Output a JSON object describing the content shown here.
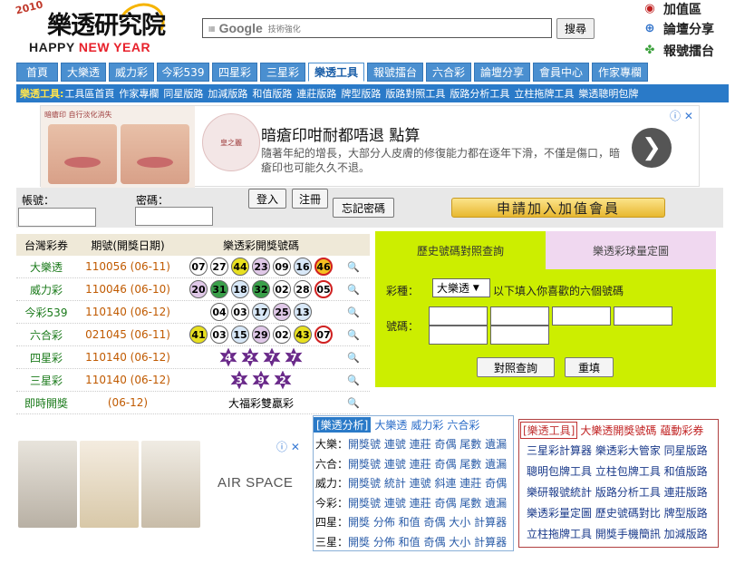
{
  "logo": {
    "year": "2010",
    "title": "樂透研究院",
    "greeting_a": "HAPPY",
    "greeting_b": "NEW YEAR"
  },
  "search": {
    "brand": "Google",
    "sub": "技術強化",
    "button": "搜尋"
  },
  "right_links": [
    "加值區",
    "論壇分享",
    "報號擂台"
  ],
  "nav": [
    {
      "label": "首頁",
      "w": 46
    },
    {
      "label": "大樂透",
      "w": 50
    },
    {
      "label": "威力彩",
      "w": 50
    },
    {
      "label": "今彩539",
      "w": 58
    },
    {
      "label": "四星彩",
      "w": 50
    },
    {
      "label": "三星彩",
      "w": 50
    },
    {
      "label": "樂透工具",
      "w": 62
    },
    {
      "label": "報號擂台",
      "w": 62
    },
    {
      "label": "六合彩",
      "w": 50
    },
    {
      "label": "論壇分享",
      "w": 62
    },
    {
      "label": "會員中心",
      "w": 62
    },
    {
      "label": "作家專欄",
      "w": 62
    }
  ],
  "nav_active": "樂透工具",
  "subnav": {
    "label": "樂透工具:",
    "items": [
      "工具區首頁",
      "作家專欄",
      "同星版路",
      "加減版路",
      "和值版路",
      "連莊版路",
      "牌型版路",
      "版路對照工具",
      "版路分析工具",
      "立柱拖牌工具",
      "樂透聰明包牌"
    ]
  },
  "ad1": {
    "caption": "暗瘡印 自行淡化消失 ",
    "brand": "皇之麗",
    "title": "暗瘡印咁耐都唔退 點算",
    "desc": "隨著年紀的增長，大部分人皮膚的修復能力都在逐年下滑，不僅是傷口，暗瘡印也可能久久不退。",
    "arrow": "❯",
    "close": "ⓘ ✕"
  },
  "login": {
    "account_label": "帳號：",
    "password_label": "密碼：",
    "login_btn": "登入",
    "register_btn": "注冊",
    "forgot_btn": "忘記密碼",
    "vip_btn": "申請加入加值會員"
  },
  "results": {
    "headers": [
      "台灣彩券",
      "期號(開獎日期)",
      "樂透彩開獎號碼",
      ""
    ],
    "rows": [
      {
        "game": "大樂透",
        "period": "110056 (06-11)",
        "type": "ball",
        "balls": [
          [
            "07",
            "#fff"
          ],
          [
            "27",
            "#fff"
          ],
          [
            "44",
            "#e8e020"
          ],
          [
            "23",
            "#e0c8e8"
          ],
          [
            "09",
            "#fff"
          ],
          [
            "16",
            "#d8e8f8"
          ],
          [
            "46",
            "#f5c020"
          ]
        ],
        "special_last": true
      },
      {
        "game": "威力彩",
        "period": "110046 (06-10)",
        "type": "ball",
        "balls": [
          [
            "20",
            "#e0c8e8"
          ],
          [
            "31",
            "#3aa04a"
          ],
          [
            "18",
            "#d8e8f8"
          ],
          [
            "32",
            "#3aa04a"
          ],
          [
            "02",
            "#fff"
          ],
          [
            "28",
            "#fff"
          ],
          [
            "05",
            "#fff"
          ]
        ],
        "special_last": true
      },
      {
        "game": "今彩539",
        "period": "110140 (06-12)",
        "type": "ball",
        "balls": [
          [
            "04",
            "#fff"
          ],
          [
            "03",
            "#fff"
          ],
          [
            "17",
            "#d8e8f8"
          ],
          [
            "25",
            "#e0c8e8"
          ],
          [
            "13",
            "#d8e8f8"
          ]
        ],
        "special_last": false
      },
      {
        "game": "六合彩",
        "period": "021045 (06-11)",
        "type": "ball",
        "balls": [
          [
            "41",
            "#e8e020"
          ],
          [
            "03",
            "#fff"
          ],
          [
            "15",
            "#d8e8f8"
          ],
          [
            "29",
            "#e0c8e8"
          ],
          [
            "02",
            "#fff"
          ],
          [
            "43",
            "#e8e020"
          ],
          [
            "07",
            "#fff"
          ]
        ],
        "special_last": true
      },
      {
        "game": "四星彩",
        "period": "110140 (06-12)",
        "type": "star",
        "balls": [
          [
            "4",
            "#6a2a8a"
          ],
          [
            "2",
            "#6a2a8a"
          ],
          [
            "7",
            "#6a2a8a"
          ],
          [
            "7",
            "#6a2a8a"
          ]
        ],
        "special_last": false
      },
      {
        "game": "三星彩",
        "period": "110140 (06-12)",
        "type": "star",
        "balls": [
          [
            "3",
            "#6a2a8a"
          ],
          [
            "9",
            "#6a2a8a"
          ],
          [
            "2",
            "#6a2a8a"
          ]
        ],
        "special_last": false
      },
      {
        "game": "即時開獎",
        "period": "(06-12)",
        "type": "text",
        "text": "大福彩雙贏彩",
        "balls": [],
        "special_last": false
      }
    ],
    "mag_icon": "🔍"
  },
  "query": {
    "tab_left": "歷史號碼對照查詢",
    "tab_right": "樂透彩球量定圖",
    "game_label": "彩種：",
    "game_value": "大樂透",
    "game_hint": "以下填入你喜歡的六個號碼",
    "number_label": "號碼：",
    "query_btn": "對照查詢",
    "reset_btn": "重填"
  },
  "ad2": {
    "brand": "AIR SPACE",
    "close": "ⓘ ✕"
  },
  "analysis": {
    "tag": "[樂透分析]",
    "links": [
      "大樂透",
      "威力彩",
      "六合彩"
    ],
    "rows": [
      {
        "k": "大樂：",
        "v": "開獎號 連號 連莊 奇偶 尾數 遺漏"
      },
      {
        "k": "六合：",
        "v": "開獎號 連號 連莊 奇偶 尾數 遺漏"
      },
      {
        "k": "威力：",
        "v": "開獎號 統計 連號 斜連 連莊 奇偶"
      },
      {
        "k": "今彩：",
        "v": "開獎號 連號 連莊 奇偶 尾數 遺漏"
      },
      {
        "k": "四星：",
        "v": "開獎 分佈 和值 奇偶 大小 計算器"
      },
      {
        "k": "三星：",
        "v": "開獎 分佈 和值 奇偶 大小 計算器"
      }
    ]
  },
  "tools": {
    "tag": "[樂透工具]",
    "head1": "大樂透開獎號碼",
    "head2": "蘊動彩券",
    "rows": [
      "三星彩計算器 樂透彩大管家 同星版路",
      "聰明包牌工具 立柱包牌工具 和值版路",
      "樂研報號統計 版路分析工具 連莊版路",
      "樂透彩量定圖 歷史號碼對比 牌型版路",
      "立柱拖牌工具 開獎手機簡訊 加減版路"
    ]
  }
}
